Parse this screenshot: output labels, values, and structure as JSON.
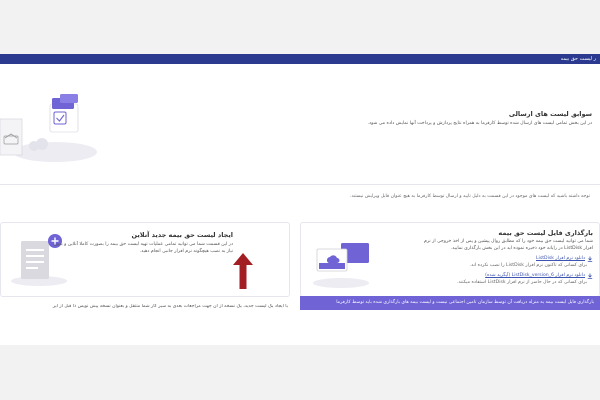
{
  "header": {
    "title": "ر لیست حق بیمه"
  },
  "history": {
    "title": "سوابق لیست های ارسالی",
    "description": "در این بخش تمامی لیست های ارسال شده توسط کارفرما به همراه نتایج پردازش و پرداخت آنها نمایش داده می شود."
  },
  "notice": {
    "text": "توجه داشته باشید که لیست های موجود در این قسمت به دلیل تایید و ارسال توسط کارفرما به هیچ عنوان قابل ویرایش نیستند."
  },
  "create_online": {
    "title": "ایجاد لیست حق بیمه جدید آنلاین",
    "description_line1": "در این قسمت شما می توانید تمامی عملیات تهیه لیست حق بیمه را بصورت کاملا آنلاین و بدون",
    "description_line2": "نیاز به نصب هیچگونه نرم افزار جانبی انجام دهید."
  },
  "upload_file": {
    "title": "بارگذاری فایل لیست حق بیمه",
    "description_line1": "شما می توانید لیست حق بیمه خود را که مطابق روال پیشین و پس از اخذ خروجی از نرم",
    "description_line2": "افزار ListDisk در رایانه خود ذخیره نموده اید در این بخش بارگذاری نمایید.",
    "links": [
      {
        "label": "دانلود نرم افزار ListDisk",
        "note": "برای کسانی که تاکنون نرم افزار ListDisk را نصب نکرده اند."
      },
      {
        "label": "دانلود نرم افزار ListDisk_version_6 (آپگرید شده)",
        "note": "برای کسانی که در حال حاضر از نرم افزار ListDisk استفاده میکنند."
      }
    ]
  },
  "banner": {
    "text": "بارگذاری فایل لیست بیمه به منزله دریافت آن توسط سازمان تامین اجتماعی نیست و لیست بیمه های بارگذاری شده باید توسط کارفرما"
  },
  "bottom": {
    "text": "با ایجاد یک لیست جدید، یک نسخه از آن جهت مراجعات بعدی به سیر کار شما منتقل و بعنوان نسخه پیش نویس ذا قبل از ایر"
  },
  "colors": {
    "header": "#2b3a8f",
    "banner": "#6f63d6",
    "arrow": "#a31e22",
    "illustration_purple": "#6f63d6"
  },
  "icons": [
    "envelope-icon",
    "checkbox-icon",
    "cloud-icon",
    "document-icon",
    "plus-icon",
    "download-icon",
    "arrow-up-icon"
  ]
}
